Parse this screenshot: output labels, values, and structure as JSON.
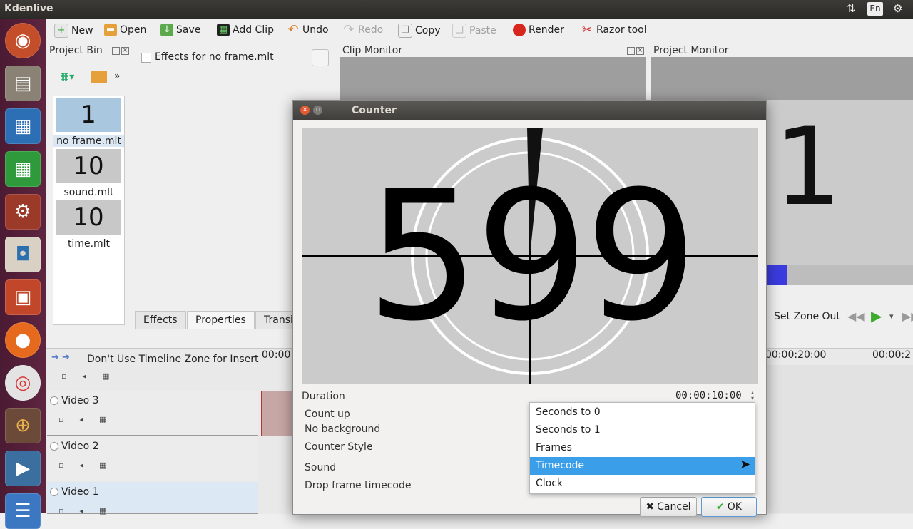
{
  "app": {
    "title": "Kdenlive",
    "lang_indicator": "En"
  },
  "toolbar": {
    "new": "New",
    "open": "Open",
    "save": "Save",
    "add_clip": "Add Clip",
    "undo": "Undo",
    "redo": "Redo",
    "copy": "Copy",
    "paste": "Paste",
    "render": "Render",
    "razor": "Razor tool"
  },
  "project_bin": {
    "title": "Project Bin",
    "clips": [
      {
        "thumb": "1",
        "name": "no frame.mlt"
      },
      {
        "thumb": "10",
        "name": "sound.mlt"
      },
      {
        "thumb": "10",
        "name": "time.mlt"
      }
    ]
  },
  "effects_panel": {
    "label": "Effects for no frame.mlt"
  },
  "tabs": {
    "effects": "Effects",
    "properties": "Properties",
    "transitions": "Transi"
  },
  "clip_monitor": {
    "title": "Clip Monitor"
  },
  "project_monitor": {
    "title": "Project Monitor",
    "digit": "1",
    "set_zone_out": "Set Zone Out"
  },
  "timeline": {
    "zone_toggle": "Don't Use Timeline Zone for Insert",
    "ruler": [
      "00:00",
      "00:00:20:00",
      "00:00:2"
    ],
    "tracks": [
      "Video 3",
      "Video 2",
      "Video 1"
    ]
  },
  "dialog": {
    "title": "Counter",
    "preview_number": "599",
    "duration_label": "Duration",
    "duration_value": "00:00:10:00",
    "count_up": "Count up",
    "no_background": "No background",
    "counter_style": "Counter Style",
    "sound": "Sound",
    "drop_frame": "Drop frame timecode",
    "cancel": "Cancel",
    "ok": "OK",
    "style_options": [
      "Seconds to 0",
      "Seconds to 1",
      "Frames",
      "Timecode",
      "Clock"
    ],
    "selected_option": "Timecode"
  },
  "colors": {
    "accent": "#3b9ee8",
    "launcher": "#5e2540",
    "render_red": "#d9261c"
  }
}
